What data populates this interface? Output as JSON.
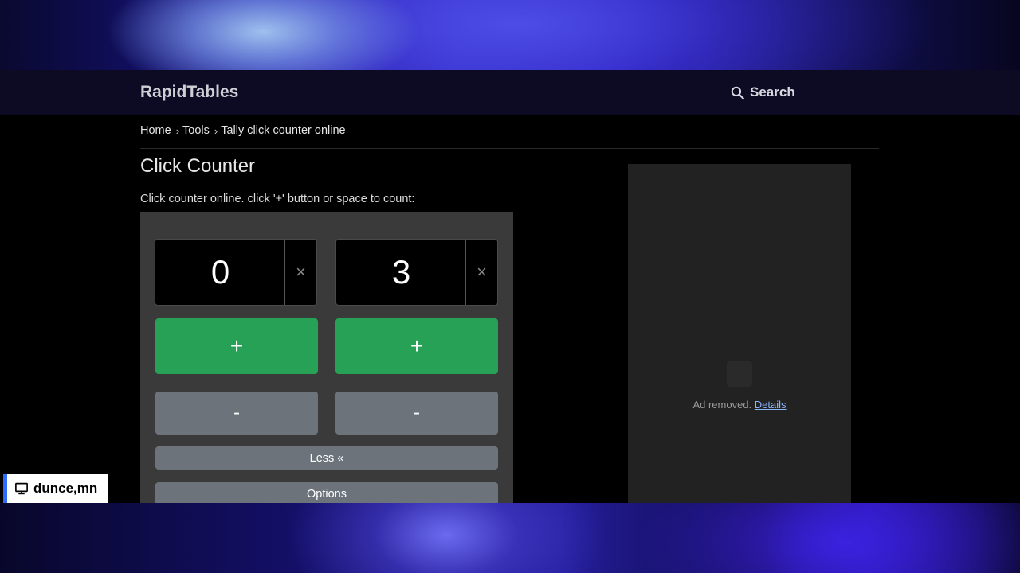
{
  "header": {
    "logo": "RapidTables",
    "search_label": "Search"
  },
  "breadcrumb": {
    "items": [
      "Home",
      "Tools",
      "Tally click counter online"
    ],
    "separator": "›"
  },
  "page": {
    "title": "Click Counter",
    "intro": "Click counter online. click '+' button or space to count:"
  },
  "counters": [
    {
      "value": "0",
      "reset_label": "×",
      "plus_label": "+",
      "minus_label": "-"
    },
    {
      "value": "3",
      "reset_label": "×",
      "plus_label": "+",
      "minus_label": "-"
    }
  ],
  "controls": {
    "less_label": "Less «",
    "options_label": "Options"
  },
  "ad": {
    "text": "Ad removed.",
    "link": "Details"
  },
  "badge": {
    "label": "dunce,mn",
    "icon": "monitor-icon"
  },
  "colors": {
    "plus_button": "#27a155",
    "minus_button": "#6c737a",
    "panel": "#3a3a3a",
    "header": "#0d0a24"
  }
}
